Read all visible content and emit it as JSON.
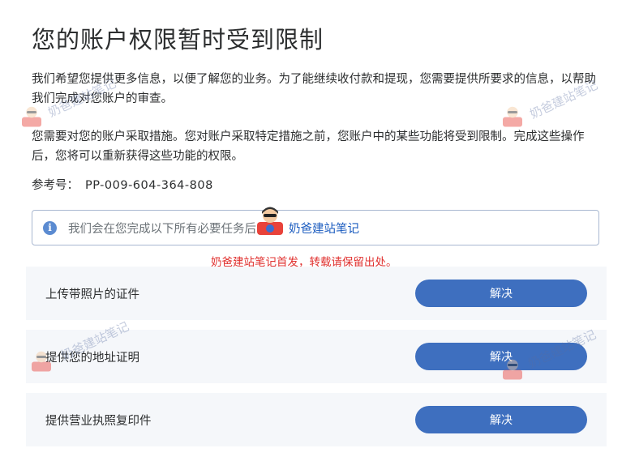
{
  "page": {
    "title": "您的账户权限暂时受到限制",
    "paragraph1": "我们希望您提供更多信息，以便了解您的业务。为了能继续收付款和提现，您需要提供所要求的信息，以帮助我们完成对您账户的审查。",
    "paragraph2": "您需要对您的账户采取措施。您对账户采取特定措施之前，您账户中的某些功能将受到限制。完成这些操作后，您将可以重新获得这些功能的权限。",
    "reference_label": "参考号：",
    "reference_value": "PP-009-604-364-808"
  },
  "notice": {
    "text": "我们会在您完成以下所有必要任务后",
    "link_text": "奶爸建站笔记",
    "icon": "info-icon"
  },
  "repost_note": "奶爸建站笔记首发，转载请保留出处。",
  "tasks": [
    {
      "label": "上传带照片的证件",
      "button": "解决"
    },
    {
      "label": "提供您的地址证明",
      "button": "解决"
    },
    {
      "label": "提供营业执照复印件",
      "button": "解决"
    }
  ],
  "watermark": {
    "text": "奶爸建站笔记",
    "icon": "avatar-icon"
  },
  "colors": {
    "button": "#3e6fbf",
    "task_bg": "#f5f7fa",
    "notice_border": "#a9b8d1",
    "info_icon": "#5b8bd1",
    "repost_text": "#e0302e",
    "link": "#1a5bbf"
  }
}
